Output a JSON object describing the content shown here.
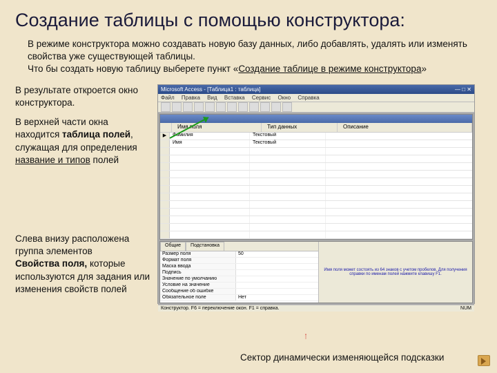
{
  "title": "Создание таблицы с помощью конструктора:",
  "intro": {
    "p1a": "В режиме конструктора можно создавать новую базу данных, либо добавлять, удалять или изменять свойства уже существующей таблицы.",
    "p2a": "Что бы создать новую таблицу выберете пункт «",
    "p2link": "Создание таблице в режиме конструктора",
    "p2b": "»"
  },
  "left": {
    "p1": "В результате откроется окно конструктора.",
    "p2a": "В верхней части окна находится ",
    "p2b": "таблица полей",
    "p2c": ", служащая для определения ",
    "p2d": "название и типов",
    "p2e": " полей",
    "p3a": "Слева внизу расположена группа элементов ",
    "p3b": "Свойства поля,",
    "p3c": " которые используются для задания или изменения свойств полей"
  },
  "app": {
    "title": "Microsoft Access - [Таблица1 : таблица]",
    "menu": [
      "Файл",
      "Правка",
      "Вид",
      "Вставка",
      "Сервис",
      "Окно",
      "Справка"
    ],
    "col1": "Имя поля",
    "col2": "Тип данных",
    "col3": "Описание",
    "rows": [
      {
        "key": "▶",
        "name": "Фамилия",
        "type": "Текстовый"
      },
      {
        "key": "",
        "name": "Имя",
        "type": "Текстовый"
      }
    ],
    "tabs": [
      "Общие",
      "Подстановка"
    ],
    "props": [
      {
        "k": "Размер поля",
        "v": "50"
      },
      {
        "k": "Формат поля",
        "v": ""
      },
      {
        "k": "Маска ввода",
        "v": ""
      },
      {
        "k": "Подпись",
        "v": ""
      },
      {
        "k": "Значение по умолчанию",
        "v": ""
      },
      {
        "k": "Условие на значение",
        "v": ""
      },
      {
        "k": "Сообщение об ошибке",
        "v": ""
      },
      {
        "k": "Обязательное поле",
        "v": "Нет"
      }
    ],
    "hint": "Имя поля может состоять из 64 знаков с учетом пробелов. Для получения справки по именам полей нажмите клавишу F1.",
    "status_left": "Конструктор. F6 = переключение окон. F1 = справка.",
    "status_right": "NUM"
  },
  "caption": "Сектор динамически изменяющейся подсказки"
}
